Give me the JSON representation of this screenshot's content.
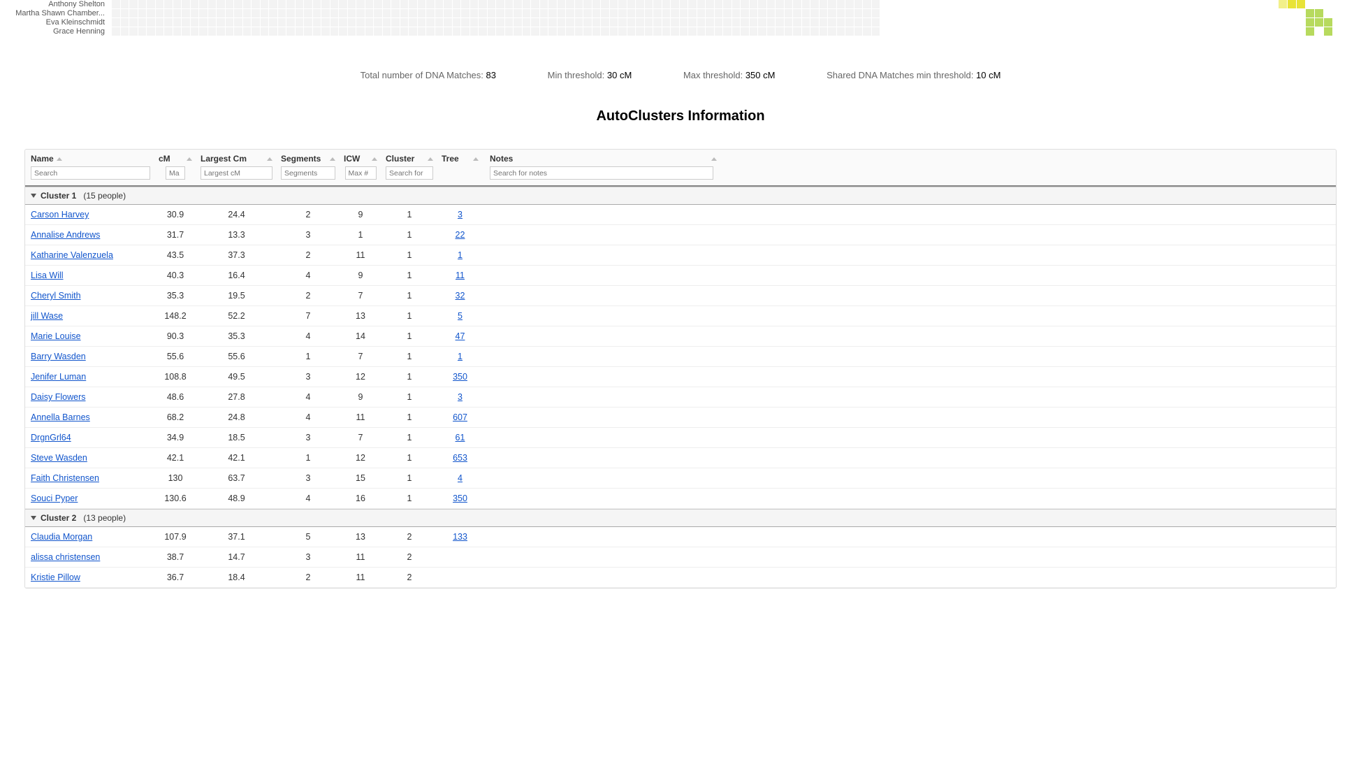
{
  "side_names": [
    "Anthony Shelton",
    "Martha Shawn Chamber...",
    "Eva Kleinschmidt",
    "Grace Henning"
  ],
  "corner": {
    "yellow": "#e8e337",
    "green": "#b7da5e",
    "lightyellow": "#f2f08a"
  },
  "stats": {
    "total_label": "Total number of DNA Matches:",
    "total_value": "83",
    "min_label": "Min threshold:",
    "min_value": "30 cM",
    "max_label": "Max threshold:",
    "max_value": "350 cM",
    "shared_label": "Shared DNA Matches min threshold:",
    "shared_value": "10 cM"
  },
  "section_title": "AutoClusters Information",
  "headers": {
    "name": "Name",
    "cm": "cM",
    "lcm": "Largest Cm",
    "seg": "Segments",
    "icw": "ICW",
    "cluster": "Cluster",
    "tree": "Tree",
    "notes": "Notes"
  },
  "placeholders": {
    "name": "Search",
    "cm": "Ma",
    "lcm": "Largest cM",
    "seg": "Segments",
    "icw": "Max #",
    "cluster": "Search for",
    "notes": "Search for notes"
  },
  "groups": [
    {
      "title": "Cluster 1",
      "count": "(15 people)",
      "rows": [
        {
          "name": "Carson Harvey",
          "cm": "30.9",
          "lcm": "24.4",
          "seg": "2",
          "icw": "9",
          "cluster": "1",
          "tree": "3"
        },
        {
          "name": "Annalise Andrews",
          "cm": "31.7",
          "lcm": "13.3",
          "seg": "3",
          "icw": "1",
          "cluster": "1",
          "tree": "22"
        },
        {
          "name": "Katharine Valenzuela",
          "cm": "43.5",
          "lcm": "37.3",
          "seg": "2",
          "icw": "11",
          "cluster": "1",
          "tree": "1"
        },
        {
          "name": "Lisa Will",
          "cm": "40.3",
          "lcm": "16.4",
          "seg": "4",
          "icw": "9",
          "cluster": "1",
          "tree": "11"
        },
        {
          "name": "Cheryl Smith",
          "cm": "35.3",
          "lcm": "19.5",
          "seg": "2",
          "icw": "7",
          "cluster": "1",
          "tree": "32"
        },
        {
          "name": "jill Wase",
          "cm": "148.2",
          "lcm": "52.2",
          "seg": "7",
          "icw": "13",
          "cluster": "1",
          "tree": "5"
        },
        {
          "name": "Marie Louise",
          "cm": "90.3",
          "lcm": "35.3",
          "seg": "4",
          "icw": "14",
          "cluster": "1",
          "tree": "47"
        },
        {
          "name": "Barry Wasden",
          "cm": "55.6",
          "lcm": "55.6",
          "seg": "1",
          "icw": "7",
          "cluster": "1",
          "tree": "1"
        },
        {
          "name": "Jenifer Luman",
          "cm": "108.8",
          "lcm": "49.5",
          "seg": "3",
          "icw": "12",
          "cluster": "1",
          "tree": "350"
        },
        {
          "name": "Daisy Flowers",
          "cm": "48.6",
          "lcm": "27.8",
          "seg": "4",
          "icw": "9",
          "cluster": "1",
          "tree": "3"
        },
        {
          "name": "Annella Barnes",
          "cm": "68.2",
          "lcm": "24.8",
          "seg": "4",
          "icw": "11",
          "cluster": "1",
          "tree": "607"
        },
        {
          "name": "DrgnGrl64",
          "cm": "34.9",
          "lcm": "18.5",
          "seg": "3",
          "icw": "7",
          "cluster": "1",
          "tree": "61"
        },
        {
          "name": "Steve Wasden",
          "cm": "42.1",
          "lcm": "42.1",
          "seg": "1",
          "icw": "12",
          "cluster": "1",
          "tree": "653"
        },
        {
          "name": "Faith Christensen",
          "cm": "130",
          "lcm": "63.7",
          "seg": "3",
          "icw": "15",
          "cluster": "1",
          "tree": "4"
        },
        {
          "name": "Souci Pyper",
          "cm": "130.6",
          "lcm": "48.9",
          "seg": "4",
          "icw": "16",
          "cluster": "1",
          "tree": "350"
        }
      ]
    },
    {
      "title": "Cluster 2",
      "count": "(13 people)",
      "rows": [
        {
          "name": "Claudia Morgan",
          "cm": "107.9",
          "lcm": "37.1",
          "seg": "5",
          "icw": "13",
          "cluster": "2",
          "tree": "133"
        },
        {
          "name": "alissa christensen",
          "cm": "38.7",
          "lcm": "14.7",
          "seg": "3",
          "icw": "11",
          "cluster": "2",
          "tree": ""
        },
        {
          "name": "Kristie Pillow",
          "cm": "36.7",
          "lcm": "18.4",
          "seg": "2",
          "icw": "11",
          "cluster": "2",
          "tree": ""
        }
      ]
    }
  ]
}
